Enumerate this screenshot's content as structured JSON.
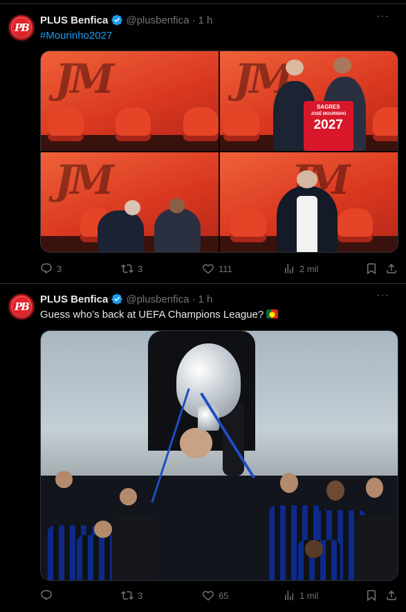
{
  "tweets": [
    {
      "author_name": "PLUS Benfica",
      "handle": "@plusbenfica",
      "separator": "·",
      "time": "1 h",
      "more": "···",
      "avatar_text": "PB",
      "text": "#Mourinho2027",
      "media": {
        "type": "photo-grid",
        "count": 4,
        "jersey_top": "SAGRES",
        "jersey_name": "JOSÉ MOURINHO",
        "jersey_number": "2027",
        "backdrop_letters": "JM"
      },
      "actions": {
        "replies": "3",
        "reposts": "3",
        "likes": "111",
        "views": "2 mil"
      }
    },
    {
      "author_name": "PLUS Benfica",
      "handle": "@plusbenfica",
      "separator": "·",
      "time": "1 h",
      "more": "···",
      "avatar_text": "PB",
      "text": "Guess who’s back at UEFA Champions League?",
      "text_flag": "portugal-flag",
      "media": {
        "type": "photo",
        "count": 1
      },
      "actions": {
        "replies": "",
        "reposts": "3",
        "likes": "65",
        "views": "1 mil"
      }
    }
  ],
  "colors": {
    "background": "#000000",
    "text": "#e7e9ea",
    "muted": "#71767b",
    "link": "#1d9bf0",
    "border": "#2f3336",
    "verified": "#1d9bf0"
  },
  "icons": {
    "reply": "reply-icon",
    "repost": "repost-icon",
    "like": "heart-icon",
    "views": "views-icon",
    "bookmark": "bookmark-icon",
    "share": "share-icon",
    "verified": "verified-badge-icon",
    "more": "more-icon"
  }
}
